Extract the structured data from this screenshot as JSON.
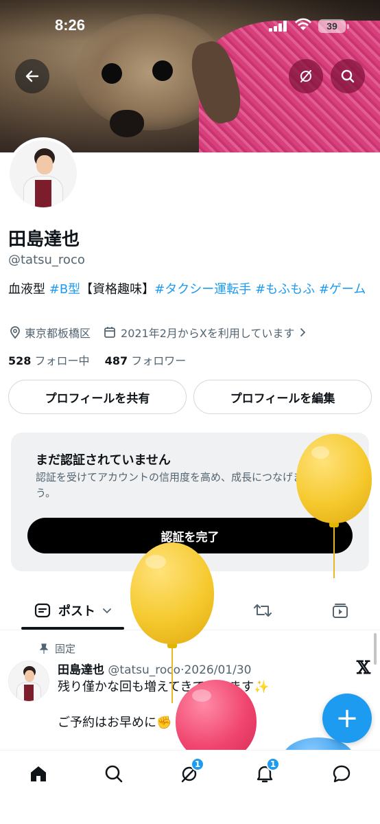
{
  "status_bar": {
    "time": "8:26",
    "battery": "39"
  },
  "profile": {
    "name": "田島達也",
    "handle": "@tatsu_roco",
    "bio_segments": [
      {
        "text": "血液型 ",
        "type": "text"
      },
      {
        "text": "#B型",
        "type": "tag"
      },
      {
        "text": "【資格趣味】",
        "type": "text"
      },
      {
        "text": "#タクシー運転手",
        "type": "tag"
      },
      {
        "text": " ",
        "type": "text"
      },
      {
        "text": "#もふもふ",
        "type": "tag"
      },
      {
        "text": " ",
        "type": "text"
      },
      {
        "text": "#ゲーム",
        "type": "tag"
      }
    ],
    "location": "東京都板橋区",
    "joined": "2021年2月からXを利用しています",
    "following_count": "528",
    "following_label": "フォロー中",
    "followers_count": "487",
    "followers_label": "フォロワー"
  },
  "buttons": {
    "share_profile": "プロフィールを共有",
    "edit_profile": "プロフィールを編集"
  },
  "verification": {
    "title": "まだ認証されていません",
    "description": "認証を受けてアカウントの信用度を高め、成長につなげましょう。",
    "cta": "認証を完了",
    "close": "×"
  },
  "tabs": [
    {
      "label": "ポスト",
      "icon": "post-icon",
      "active": true
    },
    {
      "label": "",
      "icon": "reply-icon",
      "active": false
    },
    {
      "label": "",
      "icon": "repost-icon",
      "active": false
    },
    {
      "label": "",
      "icon": "media-icon",
      "active": false
    }
  ],
  "pinned_post": {
    "pinned_label": "固定",
    "author_name": "田島達也",
    "author_handle": "@tatsu_roco",
    "separator": "·",
    "date": "2026/01/30",
    "line1": "残り僅かな回も増えてきております✨",
    "line2": "ご予約はお早めに✊"
  },
  "fab_label": "+",
  "bottom_nav": [
    {
      "icon": "home-icon",
      "badge": ""
    },
    {
      "icon": "search-icon",
      "badge": ""
    },
    {
      "icon": "grok-icon",
      "badge": "1"
    },
    {
      "icon": "bell-icon",
      "badge": "1"
    },
    {
      "icon": "messages-icon",
      "badge": ""
    }
  ],
  "colors": {
    "accent": "#1d9bf0",
    "text_primary": "#0f1419",
    "text_secondary": "#536471",
    "balloon_yellow": "#f5c92e",
    "balloon_pink": "#f0456e",
    "balloon_blue": "#4aa8f0"
  }
}
